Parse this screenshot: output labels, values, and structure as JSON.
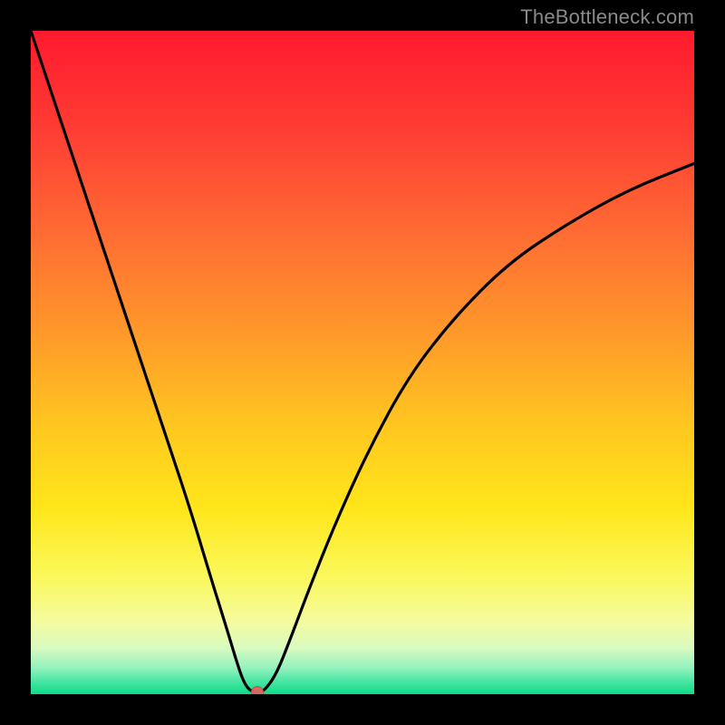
{
  "watermark": "TheBottleneck.com",
  "gradient_stops": [
    {
      "pct": 0,
      "color": "#ff1a2e"
    },
    {
      "pct": 14,
      "color": "#ff3a33"
    },
    {
      "pct": 30,
      "color": "#ff6a33"
    },
    {
      "pct": 46,
      "color": "#ff9a2a"
    },
    {
      "pct": 60,
      "color": "#ffc81f"
    },
    {
      "pct": 72,
      "color": "#ffe61a"
    },
    {
      "pct": 82,
      "color": "#faf859"
    },
    {
      "pct": 89,
      "color": "#f5fb9e"
    },
    {
      "pct": 93,
      "color": "#d9fbc0"
    },
    {
      "pct": 96,
      "color": "#95f2bf"
    },
    {
      "pct": 98,
      "color": "#4be6a4"
    },
    {
      "pct": 100,
      "color": "#0edb87"
    }
  ],
  "colors": {
    "plot_border": "#000000",
    "curve": "#000000",
    "dot": "#d46a5f"
  },
  "chart_data": {
    "type": "line",
    "title": "",
    "xlabel": "",
    "ylabel": "",
    "xlim": [
      0,
      100
    ],
    "ylim": [
      0,
      100
    ],
    "series": [
      {
        "name": "bottleneck-curve",
        "x": [
          0,
          4,
          8,
          12,
          16,
          20,
          24,
          27,
          29.5,
          31,
          32,
          33,
          34.2,
          35.2,
          37,
          39,
          42,
          46,
          51,
          57,
          64,
          72,
          81,
          90,
          100
        ],
        "y": [
          100,
          88,
          76,
          64,
          52,
          40,
          28,
          18,
          10,
          5,
          2,
          0.5,
          0.3,
          0.5,
          3,
          8,
          16,
          26,
          37,
          48,
          57,
          65,
          71,
          76,
          80
        ]
      }
    ],
    "annotations": [
      {
        "name": "marker-dot",
        "x": 34.2,
        "y": 0.3
      }
    ]
  }
}
